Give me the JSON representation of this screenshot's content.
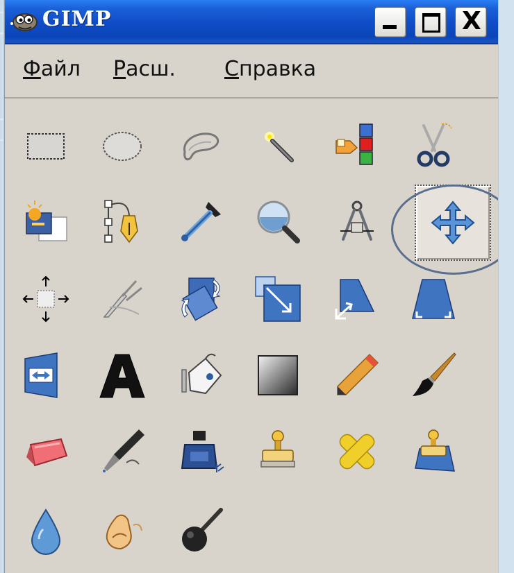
{
  "window": {
    "title": "GIMP",
    "buttons": {
      "minimize": "_",
      "maximize": "□",
      "close": "X"
    }
  },
  "menu": [
    {
      "first": "Ф",
      "rest": "айл"
    },
    {
      "first": "Р",
      "rest": "асш."
    },
    {
      "first": "С",
      "rest": "правка"
    }
  ],
  "tools": [
    "rect-select-icon",
    "ellipse-select-icon",
    "free-select-icon",
    "fuzzy-select-icon",
    "select-by-color-icon",
    "scissors-icon",
    "foreground-select-icon",
    "paths-icon",
    "color-picker-icon",
    "zoom-icon",
    "measure-icon",
    "move-icon",
    "align-icon",
    "crop-icon",
    "rotate-icon",
    "scale-icon",
    "shear-icon",
    "perspective-icon",
    "flip-icon",
    "text-icon",
    "bucket-fill-icon",
    "blend-icon",
    "pencil-icon",
    "paintbrush-icon",
    "eraser-icon",
    "airbrush-icon",
    "ink-icon",
    "clone-icon",
    "heal-icon",
    "perspective-clone-icon",
    "blur-sharpen-icon",
    "smudge-icon",
    "dodge-burn-icon"
  ],
  "active_tool": "move-icon",
  "colors": {
    "titlebar": "#0f4cc6",
    "window_bg": "#d8d3cb",
    "ring": "#5a6e8e"
  }
}
